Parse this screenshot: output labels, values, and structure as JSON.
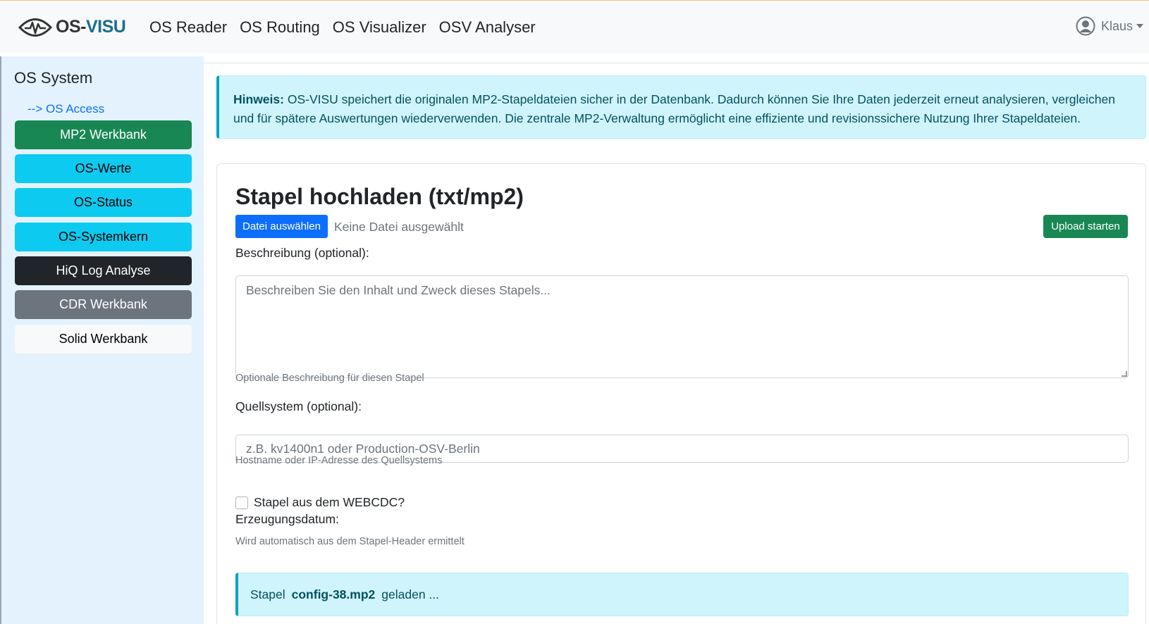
{
  "brand": {
    "name_prefix": "OS-",
    "name_suffix": "VISU"
  },
  "nav": {
    "items": [
      {
        "label": "OS Reader"
      },
      {
        "label": "OS Routing"
      },
      {
        "label": "OS Visualizer"
      },
      {
        "label": "OSV Analyser"
      }
    ],
    "user": "Klaus"
  },
  "sidebar": {
    "title": "OS System",
    "link": "--> OS Access",
    "buttons": [
      {
        "label": "MP2 Werkbank"
      },
      {
        "label": "OS-Werte"
      },
      {
        "label": "OS-Status"
      },
      {
        "label": "OS-Systemkern"
      },
      {
        "label": "HiQ Log Analyse"
      },
      {
        "label": "CDR Werkbank"
      },
      {
        "label": "Solid Werkbank"
      }
    ]
  },
  "notice": {
    "label": "Hinweis:",
    "text": "OS-VISU speichert die originalen MP2-Stapeldateien sicher in der Datenbank. Dadurch können Sie Ihre Daten jederzeit erneut analysieren, vergleichen und für spätere Auswertungen wiederverwenden. Die zentrale MP2-Verwaltung ermöglicht eine effiziente und revisionssichere Nutzung Ihrer Stapeldateien."
  },
  "upload": {
    "title": "Stapel hochladen (txt/mp2)",
    "file_button": "Datei auswählen",
    "file_status": "Keine Datei ausgewählt",
    "upload_button": "Upload starten",
    "description_label": "Beschreibung (optional):",
    "description_placeholder": "Beschreiben Sie den Inhalt und Zweck dieses Stapels...",
    "description_help": "Optionale Beschreibung für diesen Stapel",
    "source_label": "Quellsystem (optional):",
    "source_placeholder": "z.B. kv1400n1 oder Production-OSV-Berlin",
    "source_help": "Hostname oder IP-Adresse des Quellsystems",
    "webcdc_label": "Stapel aus dem WEBCDC?",
    "date_label": "Erzeugungsdatum:",
    "date_help": "Wird automatisch aus dem Stapel-Header ermittelt",
    "status_prefix": "Stapel",
    "status_file": "config-38.mp2",
    "status_suffix": "geladen ..."
  },
  "colors": {
    "primary": "#0d6efd",
    "success": "#198754",
    "info": "#0dcaf0",
    "dark": "#212529",
    "secondary": "#6c757d",
    "sidebar_bg": "#e3f2fd",
    "notice_bg": "#cff4fc"
  },
  "icons": [
    "brand-eye-pulse-icon",
    "user-circle-icon",
    "chevron-down-icon"
  ]
}
